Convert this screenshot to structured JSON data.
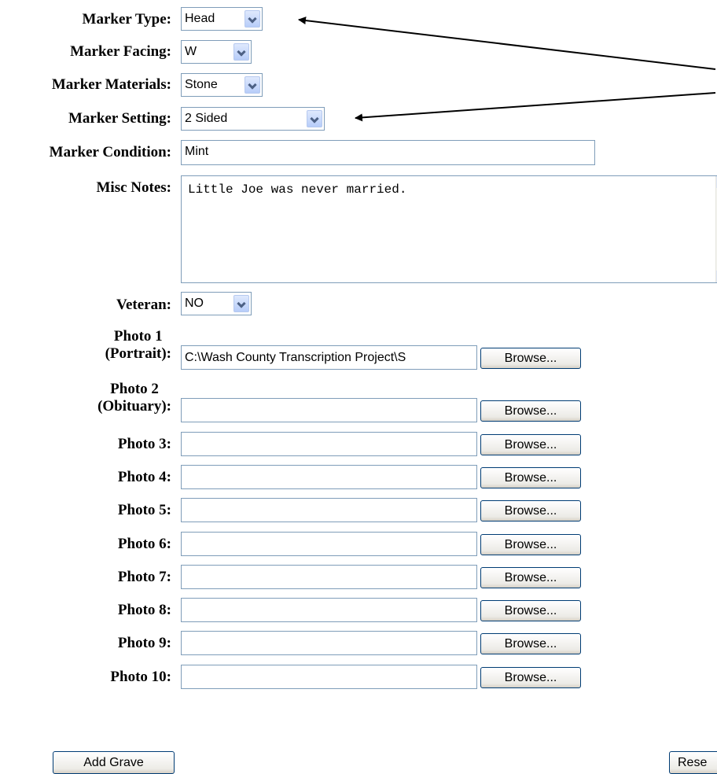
{
  "form": {
    "marker_type": {
      "label": "Marker Type:",
      "value": "Head"
    },
    "marker_facing": {
      "label": "Marker Facing:",
      "value": "W"
    },
    "marker_materials": {
      "label": "Marker Materials:",
      "value": "Stone"
    },
    "marker_setting": {
      "label": "Marker Setting:",
      "value": "2 Sided"
    },
    "marker_condition": {
      "label": "Marker Condition:",
      "value": "Mint"
    },
    "misc_notes": {
      "label": "Misc Notes:",
      "value": "Little Joe was never married."
    },
    "veteran": {
      "label": "Veteran:",
      "value": "NO"
    },
    "photos": [
      {
        "label_line1": "Photo 1",
        "label_line2": "(Portrait):",
        "value": "C:\\Wash County Transcription Project\\S"
      },
      {
        "label_line1": "Photo 2",
        "label_line2": "(Obituary):",
        "value": ""
      },
      {
        "label": "Photo 3:",
        "value": ""
      },
      {
        "label": "Photo 4:",
        "value": ""
      },
      {
        "label": "Photo 5:",
        "value": ""
      },
      {
        "label": "Photo 6:",
        "value": ""
      },
      {
        "label": "Photo 7:",
        "value": ""
      },
      {
        "label": "Photo 8:",
        "value": ""
      },
      {
        "label": "Photo 9:",
        "value": ""
      },
      {
        "label": "Photo 10:",
        "value": ""
      }
    ],
    "browse_label": "Browse...",
    "add_grave_label": "Add Grave",
    "reset_label": "Rese"
  },
  "colors": {
    "input_border": "#7f9db9",
    "dropdown_arrow_bg": "#c3d3fd",
    "button_border": "#003c74",
    "annotation_arrow": "#000000"
  },
  "icons": {
    "dropdown": "chevron-down-icon",
    "annotation": "arrow-icon"
  }
}
